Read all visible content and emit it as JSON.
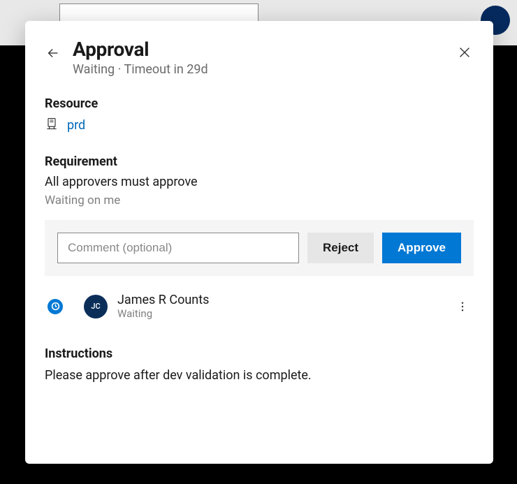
{
  "header": {
    "title": "Approval",
    "status": "Waiting",
    "separator": "·",
    "timeout": "Timeout in 29d"
  },
  "resource": {
    "label": "Resource",
    "name": "prd"
  },
  "requirement": {
    "label": "Requirement",
    "description": "All approvers must approve",
    "waiting_status": "Waiting on me"
  },
  "actions": {
    "comment_placeholder": "Comment (optional)",
    "reject_label": "Reject",
    "approve_label": "Approve"
  },
  "approvers": [
    {
      "initials": "JC",
      "name": "James R Counts",
      "status": "Waiting"
    }
  ],
  "instructions": {
    "label": "Instructions",
    "text": "Please approve after dev validation is complete."
  }
}
